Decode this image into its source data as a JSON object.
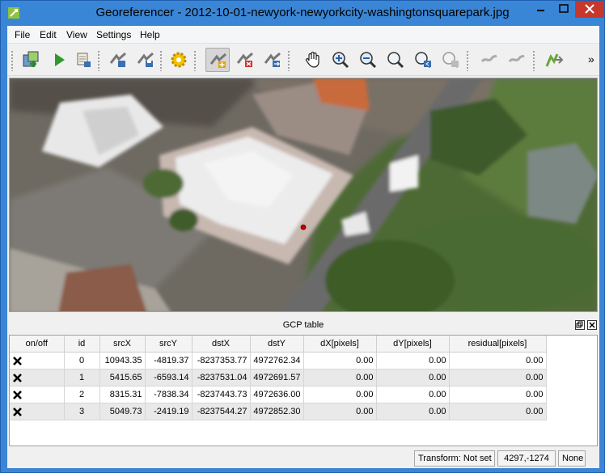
{
  "window": {
    "title": "Georeferencer - 2012-10-01-newyork-newyorkcity-washingtonsquarepark.jpg"
  },
  "menu": [
    "File",
    "Edit",
    "View",
    "Settings",
    "Help"
  ],
  "toolbar": {
    "tools": [
      {
        "name": "open-raster"
      },
      {
        "name": "start-georeferencing"
      },
      {
        "name": "generate-gdal-script"
      },
      {
        "name": "load-gcp-points"
      },
      {
        "name": "save-gcp-points"
      },
      {
        "name": "transformation-settings"
      },
      {
        "name": "add-point"
      },
      {
        "name": "delete-point"
      },
      {
        "name": "move-gcp-point"
      },
      {
        "name": "pan"
      },
      {
        "name": "zoom-in"
      },
      {
        "name": "zoom-out"
      },
      {
        "name": "zoom-to-layer"
      },
      {
        "name": "zoom-last"
      },
      {
        "name": "zoom-next"
      },
      {
        "name": "link-georeferencer-to-qgis"
      },
      {
        "name": "link-qgis-to-georeferencer"
      },
      {
        "name": "full-histogram-stretch"
      }
    ],
    "more": "»"
  },
  "dock": {
    "title": "GCP table"
  },
  "gcp_table": {
    "columns": [
      "on/off",
      "id",
      "srcX",
      "srcY",
      "dstX",
      "dstY",
      "dX[pixels]",
      "dY[pixels]",
      "residual[pixels]"
    ],
    "rows": [
      {
        "enabled": true,
        "id": "0",
        "srcX": "10943.35",
        "srcY": "-4819.37",
        "dstX": "-8237353.77",
        "dstY": "4972762.34",
        "dX": "0.00",
        "dY": "0.00",
        "residual": "0.00"
      },
      {
        "enabled": true,
        "id": "1",
        "srcX": "5415.65",
        "srcY": "-6593.14",
        "dstX": "-8237531.04",
        "dstY": "4972691.57",
        "dX": "0.00",
        "dY": "0.00",
        "residual": "0.00"
      },
      {
        "enabled": true,
        "id": "2",
        "srcX": "8315.31",
        "srcY": "-7838.34",
        "dstX": "-8237443.73",
        "dstY": "4972636.00",
        "dX": "0.00",
        "dY": "0.00",
        "residual": "0.00"
      },
      {
        "enabled": true,
        "id": "3",
        "srcX": "5049.73",
        "srcY": "-2419.19",
        "dstX": "-8237544.27",
        "dstY": "4972852.30",
        "dX": "0.00",
        "dY": "0.00",
        "residual": "0.00"
      }
    ]
  },
  "status": {
    "transform": "Transform: Not set",
    "coords": "4297,-1274",
    "crs": "None"
  },
  "colors": {
    "titlebar": "#3a86d6",
    "close": "#c7372b",
    "gcp_marker": "#c00000"
  }
}
